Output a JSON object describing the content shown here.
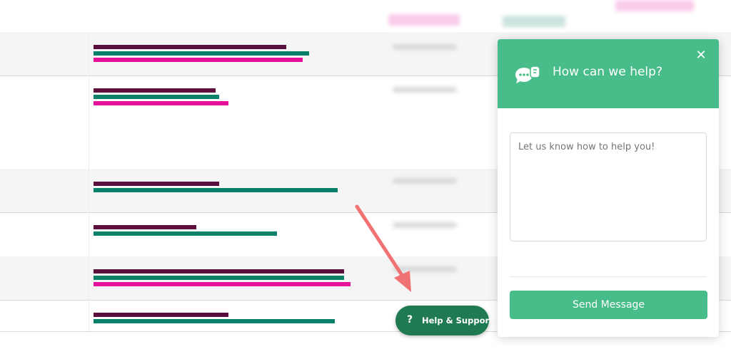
{
  "colors": {
    "series_a": "#5a0f3c",
    "series_b": "#0b8068",
    "series_c": "#e5119a",
    "widget_green": "#48bd8a",
    "help_button": "#1f7a52",
    "arrow": "#f07272"
  },
  "bar_rows": [
    {
      "shaded": true,
      "bars": [
        0.6,
        0.67,
        0.65
      ]
    },
    {
      "shaded": false,
      "bars": [
        0.38,
        0.39,
        0.42
      ]
    },
    {
      "shaded": true,
      "bars": [
        0.39,
        0.76
      ]
    },
    {
      "shaded": false,
      "bars": [
        0.32,
        0.57
      ]
    },
    {
      "shaded": true,
      "bars": [
        0.78,
        0.78,
        0.8
      ]
    },
    {
      "shaded": false,
      "bars": [
        0.42,
        0.75
      ]
    }
  ],
  "support_widget": {
    "title": "How can we help?",
    "close_icon": "close-icon",
    "header_icon": "chat-bubbles-icon",
    "message_placeholder": "Let us know how to help you!",
    "send_label": "Send Message"
  },
  "help_button": {
    "icon": "question-mark-icon",
    "icon_glyph": "?",
    "label": "Help & Support"
  },
  "annotation": {
    "icon": "pointer-arrow-icon"
  }
}
